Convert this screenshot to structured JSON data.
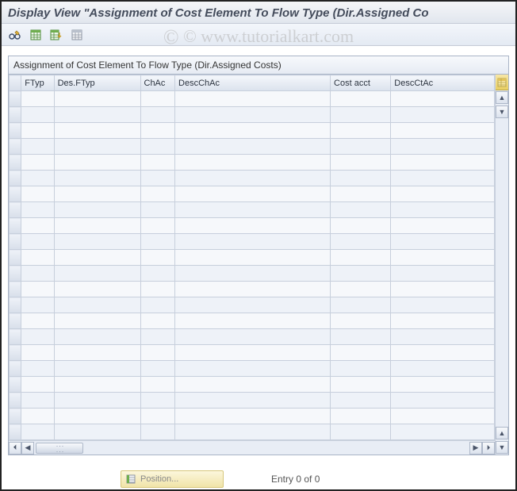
{
  "watermark": "© www.tutorialkart.com",
  "title": "Display View \"Assignment of Cost Element To Flow Type (Dir.Assigned Co",
  "toolbar": {
    "buttons": [
      {
        "name": "change-display-toggle",
        "icon": "glasses-pencil"
      },
      {
        "name": "select-all",
        "icon": "table-green"
      },
      {
        "name": "select-block",
        "icon": "table-green-arrow"
      },
      {
        "name": "deselect-all",
        "icon": "table-grey"
      }
    ]
  },
  "panel": {
    "caption": "Assignment of Cost Element To Flow Type (Dir.Assigned Costs)",
    "columns": [
      {
        "key": "ftyp",
        "label": "FTyp"
      },
      {
        "key": "desftyp",
        "label": "Des.FTyp"
      },
      {
        "key": "chac",
        "label": "ChAc"
      },
      {
        "key": "descchac",
        "label": "DescChAc"
      },
      {
        "key": "costacct",
        "label": "Cost acct"
      },
      {
        "key": "descctac",
        "label": "DescCtAc"
      }
    ],
    "row_count_visible": 22,
    "rows": []
  },
  "footer": {
    "position_label": "Position...",
    "entry_text": "Entry 0 of 0"
  }
}
